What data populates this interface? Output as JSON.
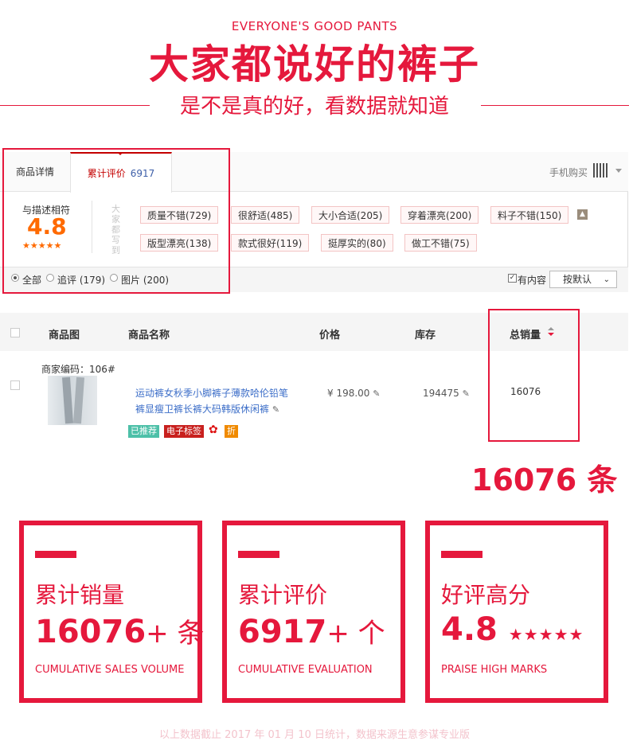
{
  "header": {
    "en_title": "EVERYONE'S GOOD PANTS",
    "cn_title": "大家都说好的裤子",
    "subtitle": "是不是真的好，看数据就知道"
  },
  "review_panel": {
    "tabs": [
      {
        "label": "商品详情"
      },
      {
        "label": "累计评价",
        "count": "6917"
      }
    ],
    "mobile_buy": "手机购买",
    "score_label": "与描述相符",
    "score": "4.8",
    "stars": "★★★★★",
    "vertical_text": "大家都写到",
    "tags": [
      "质量不错(729)",
      "很舒适(485)",
      "大小合适(205)",
      "穿着漂亮(200)",
      "料子不错(150)",
      "版型漂亮(138)",
      "款式很好(119)",
      "挺厚实的(80)",
      "做工不错(75)"
    ],
    "filters": [
      {
        "label": "全部",
        "selected": true
      },
      {
        "label": "追评 (179)",
        "selected": false
      },
      {
        "label": "图片 (200)",
        "selected": false
      }
    ],
    "has_content_label": "有内容",
    "has_content_checked": true,
    "sort_label": "按默认"
  },
  "product_table": {
    "headers": [
      "商品图",
      "商品名称",
      "价格",
      "库存",
      "总销量"
    ],
    "row": {
      "code": "商家编码：106#",
      "name": "运动裤女秋季小脚裤子薄款哈伦铅笔裤显瘦卫裤长裤大码韩版休闲裤",
      "price": "¥ 198.00",
      "stock": "194475",
      "sales": "16076",
      "badges": [
        "已推荐",
        "电子标签"
      ]
    }
  },
  "sales_callout": "16076 条",
  "cards": [
    {
      "title": "累计销量",
      "value": "16076",
      "suffix": "+ 条",
      "en": "CUMULATIVE SALES VOLUME"
    },
    {
      "title": "累计评价",
      "value": "6917",
      "suffix": "+ 个",
      "en": "CUMULATIVE EVALUATION"
    },
    {
      "title": "好评高分",
      "value": "4.8",
      "stars": "★★★★★",
      "en": "PRAISE HIGH MARKS"
    }
  ],
  "footnote": "以上数据截止 2017 年 01 月 10 日统计，数据来源生意参谋专业版",
  "colors": {
    "accent": "#e5183c",
    "score": "#ff6a00",
    "link": "#3c6ec8"
  }
}
